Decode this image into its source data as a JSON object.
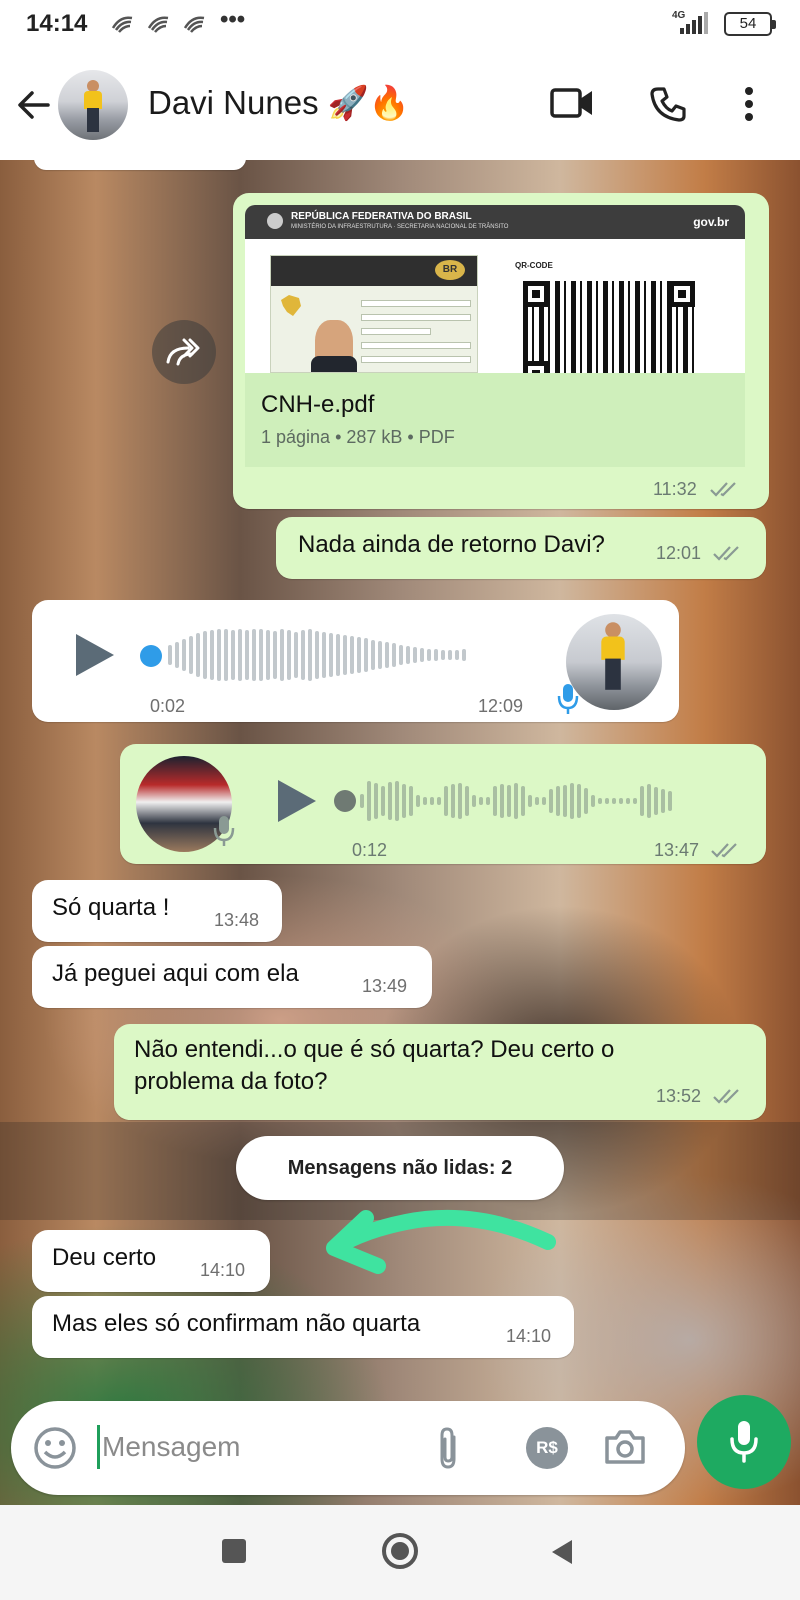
{
  "status_bar": {
    "time": "14:14",
    "network": "4G",
    "battery": "54",
    "more": "•••"
  },
  "header": {
    "contact_name": "Davi Nunes 🚀🔥"
  },
  "messages": {
    "doc": {
      "header_title": "REPÚBLICA FEDERATIVA DO BRASIL",
      "header_subtitle": "MINISTÉRIO DA INFRAESTRUTURA · SECRETARIA NACIONAL DE TRÂNSITO",
      "gov_logo": "gov.br",
      "card_badge": "BR",
      "qr_label": "QR-CODE",
      "file_name": "CNH-e.pdf",
      "file_info": "1 página • 287 kB • PDF",
      "time": "11:32"
    },
    "m1": {
      "text": "Nada ainda de retorno Davi?",
      "time": "12:01"
    },
    "voice_in": {
      "duration": "0:02",
      "time": "12:09"
    },
    "voice_out": {
      "duration": "0:12",
      "time": "13:47"
    },
    "m2": {
      "text": "Só quarta !",
      "time": "13:48"
    },
    "m3": {
      "text": "Já peguei aqui com ela",
      "time": "13:49"
    },
    "m4": {
      "text": "Não entendi...o que é só quarta? Deu certo o problema da foto?",
      "time": "13:52"
    },
    "unread": "Mensagens não lidas: 2",
    "m5": {
      "text": "Deu certo",
      "time": "14:10"
    },
    "m6": {
      "text": "Mas eles só confirmam não quarta",
      "time": "14:10"
    }
  },
  "input": {
    "placeholder": "Mensagem",
    "currency_label": "R$"
  },
  "colors": {
    "outgoing_bubble": "#dcf8c6",
    "incoming_bubble": "#ffffff",
    "accent_green": "#1eaa61",
    "read_ticks": "#8a9a94",
    "arrow_annotation": "#3fe3a0"
  },
  "icons": {
    "back": "arrow-left-icon",
    "video": "video-camera-icon",
    "call": "phone-icon",
    "menu": "more-vertical-icon",
    "forward": "forward-icon",
    "emoji": "emoji-icon",
    "attach": "paperclip-icon",
    "camera": "camera-icon",
    "mic": "microphone-icon"
  }
}
